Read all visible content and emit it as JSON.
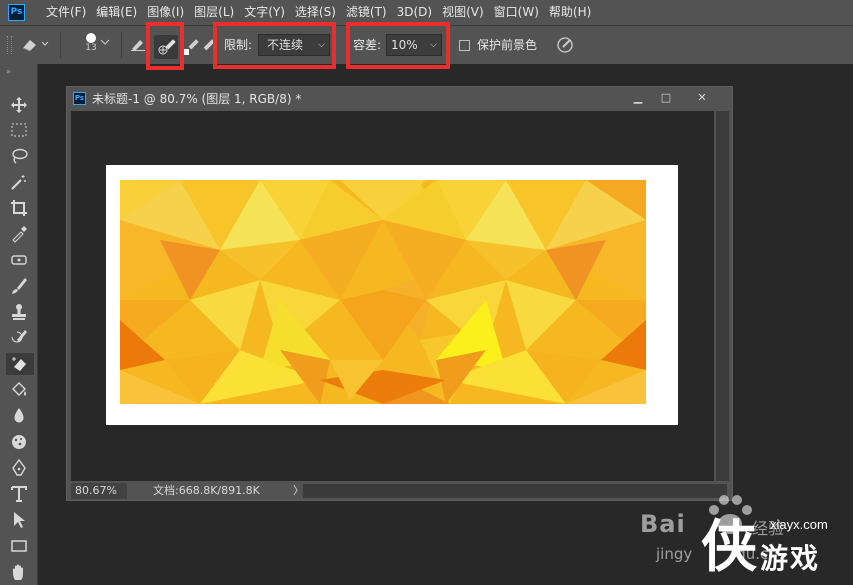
{
  "app": {
    "logo": "Ps"
  },
  "menu": [
    "文件(F)",
    "编辑(E)",
    "图像(I)",
    "图层(L)",
    "文字(Y)",
    "选择(S)",
    "滤镜(T)",
    "3D(D)",
    "视图(V)",
    "窗口(W)",
    "帮助(H)"
  ],
  "options": {
    "brush_size": "13",
    "limit_label": "限制:",
    "limit_value": "不连续",
    "tolerance_label": "容差:",
    "tolerance_value": "10%",
    "protect_label": "保护前景色",
    "highlight_color": "#ea2e2e"
  },
  "tools": [
    "move-icon",
    "marquee-icon",
    "lasso-icon",
    "magic-wand-icon",
    "crop-icon",
    "eyedropper-icon",
    "healing-icon",
    "brush-icon",
    "stamp-icon",
    "history-brush-icon",
    "background-eraser-icon",
    "paint-bucket-icon",
    "blur-icon",
    "sponge-icon",
    "pen-icon",
    "type-icon",
    "path-select-icon",
    "rectangle-icon",
    "hand-icon"
  ],
  "document": {
    "ps_icon": "Ps",
    "title": "未标题-1 @ 80.7% (图层 1, RGB/8) *",
    "zoom": "80.67%",
    "doc_info": "文档:668.8K/891.8K",
    "status_arrow": "〉"
  },
  "watermark": {
    "baidu": "Bai",
    "jingyan": "jingy",
    "jingyan2": "经验",
    "site": "xiayx.com",
    "game": "游戏",
    "logo_char": "侠",
    "dom": "du.c"
  }
}
